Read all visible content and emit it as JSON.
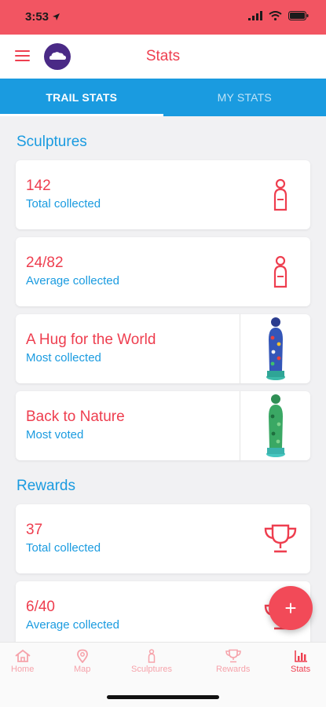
{
  "status": {
    "time": "3:53"
  },
  "header": {
    "title": "Stats"
  },
  "tabs": [
    {
      "label": "TRAIL STATS",
      "active": true
    },
    {
      "label": "MY STATS",
      "active": false
    }
  ],
  "sculptures": {
    "title": "Sculptures",
    "cards": [
      {
        "value": "142",
        "label": "Total collected"
      },
      {
        "value": "24/82",
        "label": "Average collected"
      },
      {
        "value": "A Hug for the World",
        "label": "Most collected"
      },
      {
        "value": "Back to Nature",
        "label": "Most voted"
      }
    ]
  },
  "rewards": {
    "title": "Rewards",
    "cards": [
      {
        "value": "37",
        "label": "Total collected"
      },
      {
        "value": "6/40",
        "label": "Average collected"
      }
    ]
  },
  "fab": {
    "label": "+"
  },
  "nav": [
    {
      "label": "Home",
      "icon": "home-icon"
    },
    {
      "label": "Map",
      "icon": "map-pin-icon"
    },
    {
      "label": "Sculptures",
      "icon": "sculpture-icon"
    },
    {
      "label": "Rewards",
      "icon": "trophy-icon"
    },
    {
      "label": "Stats",
      "icon": "bar-chart-icon"
    }
  ],
  "colors": {
    "accent": "#ee3e4f",
    "blue": "#1a9be0",
    "status_bar": "#f25562",
    "logo": "#4a2a86"
  }
}
